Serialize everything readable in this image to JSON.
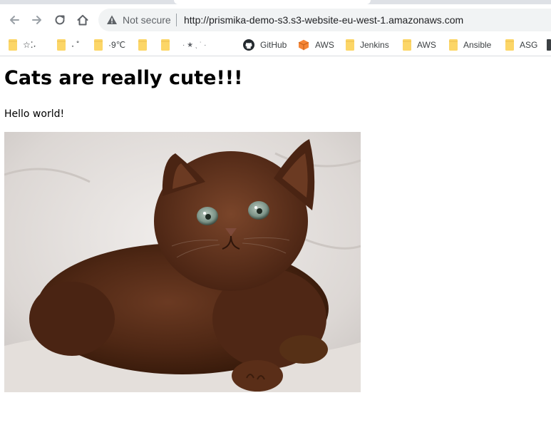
{
  "browser": {
    "security_status": "Not secure",
    "address_url": "http://prismika-demo-s3.s3-website-eu-west-1.amazonaws.com",
    "nav_icons": [
      "back-arrow-icon",
      "forward-arrow-icon",
      "reload-icon",
      "home-icon"
    ],
    "bookmarks": [
      {
        "type": "folder",
        "label": "☆⁚˖"
      },
      {
        "type": "folder",
        "label": "˖ ˚"
      },
      {
        "type": "folder",
        "label": "·9℃"
      },
      {
        "type": "folder",
        "label": ""
      },
      {
        "type": "folder",
        "label": "· ★ ˎ ˙  ·"
      },
      {
        "type": "github",
        "label": "GitHub"
      },
      {
        "type": "aws",
        "label": "AWS"
      },
      {
        "type": "folder",
        "label": "Jenkins"
      },
      {
        "type": "folder",
        "label": "AWS"
      },
      {
        "type": "folder",
        "label": "Ansible"
      },
      {
        "type": "folder",
        "label": "ASG"
      }
    ],
    "colors": {
      "folder": "#fcd667",
      "aws": "#f58536",
      "warning": "#5f6368"
    }
  },
  "page": {
    "heading": "Cats are really cute!!!",
    "paragraph": "Hello world!",
    "image_subject": "brown kitten sitting on a white blanket"
  }
}
